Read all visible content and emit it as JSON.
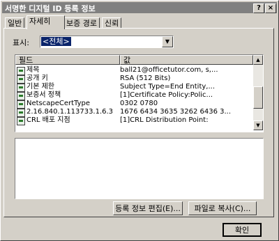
{
  "window": {
    "title": "서명한 디지털 ID 등록 정보",
    "help_button": "?",
    "close_button": "×"
  },
  "tabs": [
    {
      "label": "일반"
    },
    {
      "label": "자세히"
    },
    {
      "label": "보증 경로"
    },
    {
      "label": "신뢰"
    }
  ],
  "show": {
    "label": "표시:",
    "selected": "<전체>"
  },
  "list": {
    "columns": [
      "필드",
      "값"
    ],
    "rows": [
      {
        "field": "제목",
        "value": "ball21@officetutor.com, s,..."
      },
      {
        "field": "공개 키",
        "value": "RSA (512 Bits)"
      },
      {
        "field": "기본 제한",
        "value": "Subject Type=End Entity,..."
      },
      {
        "field": "보증서 정책",
        "value": "[1]Certificate Policy:Polic..."
      },
      {
        "field": "NetscapeCertType",
        "value": "0302 0780"
      },
      {
        "field": "2.16.840.1.113733.1.6.3",
        "value": "1676 6434 3635 3262 6436 3..."
      },
      {
        "field": "CRL 배포 지점",
        "value": "[1]CRL Distribution Point:"
      }
    ]
  },
  "buttons": {
    "edit_properties": "등록 정보 편집(E)...",
    "copy_to_file": "파일로 복사(C)...",
    "ok": "확인"
  }
}
